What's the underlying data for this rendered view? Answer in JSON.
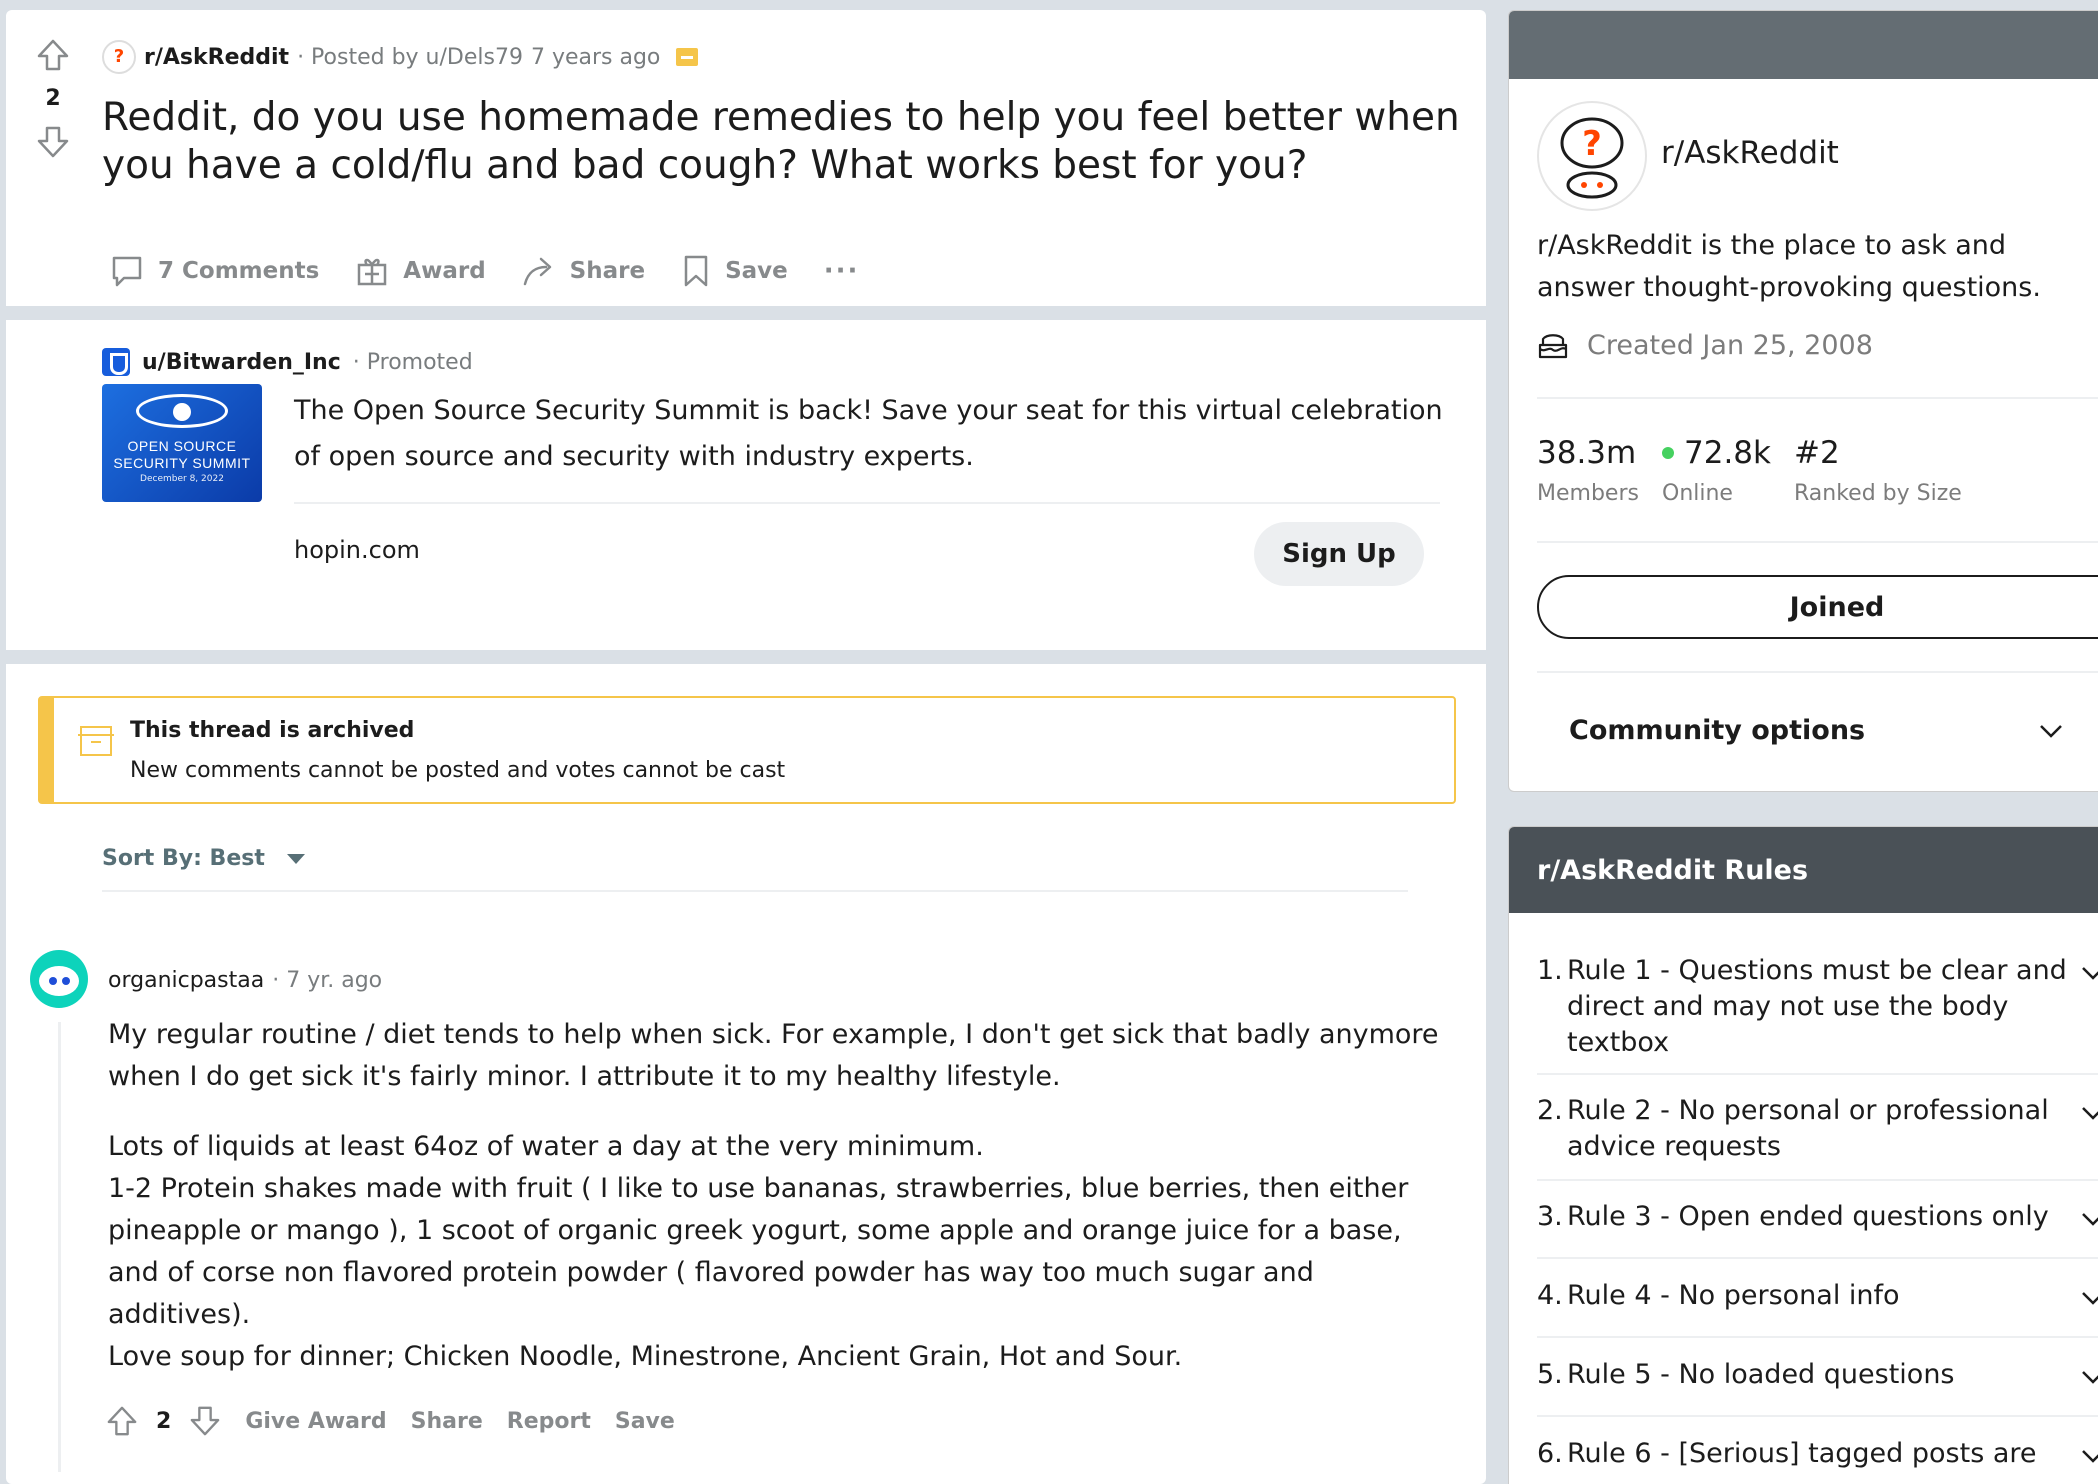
{
  "post": {
    "score": "2",
    "subreddit": "r/AskReddit",
    "posted_by": "· Posted by u/Dels79",
    "time": "7 years ago",
    "title": "Reddit, do you use homemade remedies to help you feel better when you have a cold/flu and bad cough? What works best for you?",
    "actions": {
      "comments": "7 Comments",
      "award": "Award",
      "share": "Share",
      "save": "Save",
      "more": "···"
    }
  },
  "promoted": {
    "user": "u/Bitwarden_Inc",
    "label": "· Promoted",
    "image_line1": "OPEN SOURCE",
    "image_line2": "SECURITY SUMMIT",
    "image_date": "December 8, 2022",
    "text": "The Open Source Security Summit is back! Save your seat for this virtual celebration of open source and security with industry experts.",
    "domain": "hopin.com",
    "cta": "Sign Up"
  },
  "archived": {
    "title": "This thread is archived",
    "subtitle": "New comments cannot be posted and votes cannot be cast"
  },
  "sort": {
    "label": "Sort By: Best"
  },
  "comment": {
    "author": "organicpastaa",
    "time": "· 7 yr. ago",
    "paragraph1": "My regular routine / diet tends to help when sick. For example, I don't get sick that badly anymore when I do get sick it's fairly minor. I attribute it to my healthy lifestyle.",
    "line1": "Lots of liquids at least 64oz of water a day at the very minimum.",
    "line2": "1-2 Protein shakes made with fruit ( I like to use bananas, strawberries, blue berries, then either pineapple or mango ), 1 scoot of organic greek yogurt, some apple and orange juice for a base, and of corse non flavored protein powder ( flavored powder has way too much sugar and additives).",
    "line3": "Love soup for dinner; Chicken Noodle, Minestrone, Ancient Grain, Hot and Sour.",
    "score": "2",
    "actions": {
      "give_award": "Give Award",
      "share": "Share",
      "report": "Report",
      "save": "Save"
    }
  },
  "sidebar": {
    "name": "r/AskReddit",
    "description": "r/AskReddit is the place to ask and answer thought-provoking questions.",
    "created": "Created Jan 25, 2008",
    "stats": [
      {
        "value": "38.3m",
        "label": "Members"
      },
      {
        "value": "72.8k",
        "label": "Online"
      },
      {
        "value": "#2",
        "label": "Ranked by Size"
      }
    ],
    "joined_label": "Joined",
    "community_options": "Community options"
  },
  "rules": {
    "title": "r/AskReddit Rules",
    "items": [
      {
        "num": "1.",
        "text": "Rule 1 - Questions must be clear and direct and may not use the body textbox"
      },
      {
        "num": "2.",
        "text": "Rule 2 - No personal or professional advice requests"
      },
      {
        "num": "3.",
        "text": "Rule 3 - Open ended questions only"
      },
      {
        "num": "4.",
        "text": "Rule 4 - No personal info"
      },
      {
        "num": "5.",
        "text": "Rule 5 - No loaded questions"
      },
      {
        "num": "6.",
        "text": "Rule 6 - [Serious] tagged posts are"
      }
    ]
  },
  "colors": {
    "accent_green": "#46d160",
    "archive_yellow": "#f5c54a",
    "sidebar_banner": "#646d73",
    "rules_header": "#4a5157"
  }
}
